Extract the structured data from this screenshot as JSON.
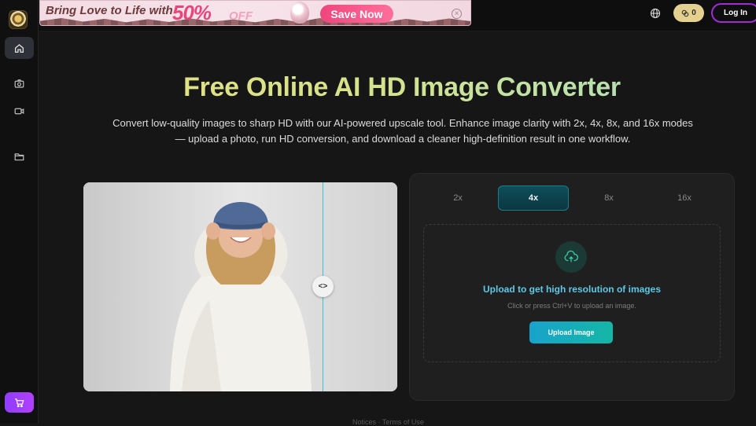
{
  "app": {
    "logo_icon": "app-logo-icon"
  },
  "sidebar": {
    "items": [
      {
        "name": "home",
        "icon": "home-icon",
        "active": true
      },
      {
        "name": "camera",
        "icon": "camera-icon",
        "active": false
      },
      {
        "name": "video",
        "icon": "video-icon",
        "active": false
      },
      {
        "name": "folder",
        "icon": "folder-icon",
        "active": false
      }
    ],
    "cart_icon": "cart-icon"
  },
  "banner": {
    "text": "Bring Love to Life with",
    "percent": "50%",
    "off": "OFF",
    "cta": "Save Now",
    "close": "×"
  },
  "header": {
    "credits": "0",
    "login": "Log In"
  },
  "hero": {
    "title": "Free Online AI HD Image Converter",
    "subtitle": "Convert low-quality images to sharp HD with our AI-powered upscale tool. Enhance image clarity with 2x, 4x, 8x, and 16x modes — upload a photo, run HD conversion, and download a cleaner high-definition result in one workflow."
  },
  "preview": {
    "handle_label": "<>"
  },
  "upscale": {
    "tabs": [
      {
        "label": "2x",
        "active": false
      },
      {
        "label": "4x",
        "active": true
      },
      {
        "label": "8x",
        "active": false
      },
      {
        "label": "16x",
        "active": false
      }
    ],
    "upload_title": "Upload to get high resolution of images",
    "upload_hint": "Click or press Ctrl+V to upload an image.",
    "upload_button": "Upload Image"
  },
  "footer": {
    "text": "Notices  ·  Terms of Use"
  },
  "colors": {
    "accent": "#5fc8e6",
    "cta_purple": "#a12ad4",
    "tab_active": "#0d4e5a"
  }
}
